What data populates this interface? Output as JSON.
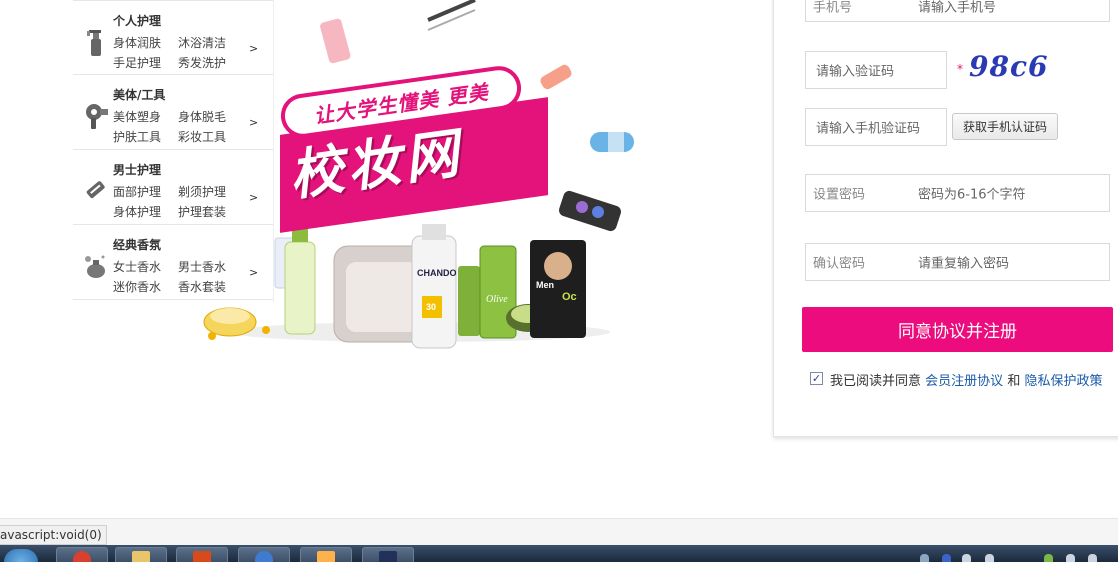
{
  "categories": [
    {
      "title": "个人护理",
      "icon": "spray-bottle-icon",
      "items": [
        "身体润肤",
        "沐浴清洁",
        "手足护理",
        "秀发洗护"
      ],
      "arrow": ">"
    },
    {
      "title": "美体/工具",
      "icon": "hair-dryer-icon",
      "items": [
        "美体塑身",
        "身体脱毛",
        "护肤工具",
        "彩妆工具"
      ],
      "arrow": ">"
    },
    {
      "title": "男士护理",
      "icon": "razor-icon",
      "items": [
        "面部护理",
        "剃须护理",
        "身体护理",
        "护理套装"
      ],
      "arrow": ">"
    },
    {
      "title": "经典香氛",
      "icon": "perfume-icon",
      "items": [
        "女士香水",
        "男士香水",
        "迷你香水",
        "香水套装"
      ],
      "arrow": ">"
    }
  ],
  "banner": {
    "slogan": "让大学生懂美 更美",
    "site_name": "校妆网",
    "brand_labels": [
      "CHANDO",
      "Olive",
      "Men",
      "Oc",
      "30"
    ]
  },
  "registration": {
    "phone": {
      "label": "手机号",
      "placeholder": "请输入手机号"
    },
    "captcha": {
      "placeholder": "请输入验证码",
      "required_mark": "*",
      "image_text": "98c6"
    },
    "sms_code": {
      "placeholder": "请输入手机验证码",
      "button": "获取手机认证码"
    },
    "password": {
      "label": "设置密码",
      "placeholder": "密码为6-16个字符"
    },
    "confirm": {
      "label": "确认密码",
      "placeholder": "请重复输入密码"
    },
    "submit": "同意协议并注册",
    "agreement": {
      "checked": true,
      "check_glyph": "✓",
      "prefix": "我已阅读并同意",
      "link1": "会员注册协议",
      "conj": "和",
      "link2": "隐私保护政策"
    }
  },
  "status_bar": {
    "text": "avascript:void(0)"
  },
  "colors": {
    "accent": "#ec0c7d",
    "link": "#1a5aa8",
    "captcha": "#2a3ab5"
  }
}
